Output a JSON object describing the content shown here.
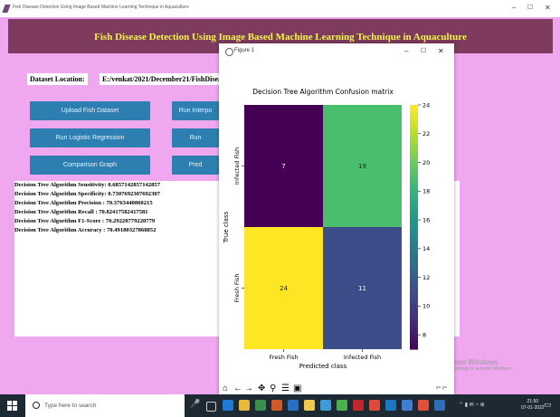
{
  "app": {
    "window_title": "Fish Disease Detection Using Image Based Machine Learning Technique in Aquaculture",
    "banner_title": "Fish Disease Detection Using Image Based Machine Learning Technique in Aquaculture",
    "dataset_label": "Dataset Location:",
    "dataset_path": "E:/venkat/2021/December21/FishDisea",
    "buttons": {
      "upload": "Upload Fish Dataset",
      "run_interp": "Run Interpo",
      "logistic": "Run Logistic Regression",
      "run2": "Run",
      "comparison": "Comparison Graph",
      "pred": "Pred"
    },
    "output_lines": [
      "Decision Tree Algorithm Sensitivity: 0.6857142857142857",
      "Decision Tree Algorithm Specificity: 0.7307692307692307",
      "Decision Tree Algorithm Precision : 70.3763440860215",
      "Decision Tree Algorithm Recall    : 70.82417582417581",
      "Decision Tree Algorithm F1-Score  : 70.29220779220779",
      "Decision Tree Algorithm Accuracy  : 70.49180327868852"
    ],
    "watermark": {
      "line1": "Activate Windows",
      "line2": "Go to Settings to activate Windows."
    }
  },
  "figure": {
    "window_title": "Figure 1",
    "toolbar_icons": [
      "home-icon",
      "back-icon",
      "forward-icon",
      "pan-icon",
      "zoom-icon",
      "configure-icon",
      "save-icon"
    ],
    "coords_text": "x= y="
  },
  "chart_data": {
    "type": "heatmap",
    "title": "Decision Tree Algorithm Confusion matrix",
    "xlabel": "Predicted class",
    "ylabel": "True class",
    "x_categories": [
      "Fresh Fish",
      "Infected Fish"
    ],
    "y_categories": [
      "Infected Fish",
      "Fresh Fish"
    ],
    "values": [
      [
        7,
        19
      ],
      [
        24,
        11
      ]
    ],
    "colorbar": {
      "min": 7,
      "max": 24,
      "ticks": [
        8,
        10,
        12,
        14,
        16,
        18,
        20,
        22,
        24
      ]
    },
    "colormap": [
      "#440154",
      "#482878",
      "#3e4989",
      "#31688e",
      "#26828e",
      "#1f9e89",
      "#35b779",
      "#6ece58",
      "#b5de2b",
      "#fde725"
    ],
    "grid": false
  },
  "taskbar": {
    "search_placeholder": "Type here to search",
    "time": "21:50",
    "date": "07-01-2022"
  }
}
